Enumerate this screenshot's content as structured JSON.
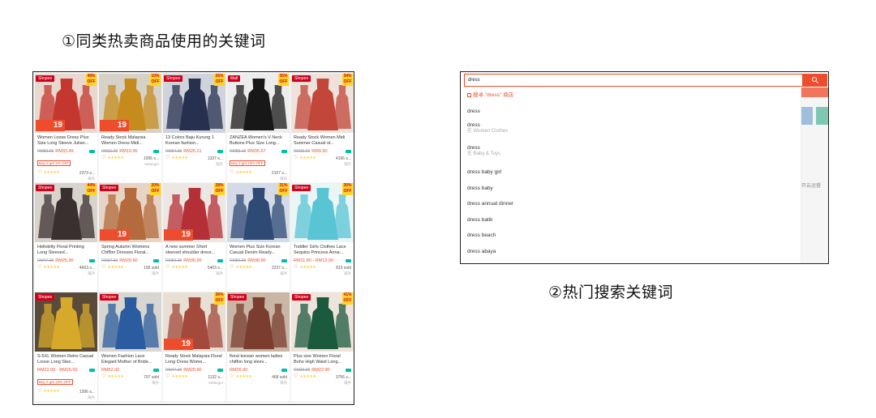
{
  "captions": {
    "similar_products": "①同类热卖商品使用的关键词",
    "hot_search": "②热门搜索关键词"
  },
  "products": [
    {
      "title": "Women Loose Dress Plus Size Long Sleeve Julian...",
      "old_price": "RM50.00",
      "price": "RM33.49",
      "promo": "Buy 2 get 3% OFF",
      "sold": "2373 s...",
      "location": "海外",
      "mall": "Shopee",
      "discount": "49% OFF",
      "sale": "19",
      "color": "#c4372e",
      "bg": "#ead7cf"
    },
    {
      "title": "Ready Stock Malaysia Women Dress Midi...",
      "old_price": "RM21.00",
      "price": "RM19.90",
      "promo": "",
      "sold": "1095 s...",
      "location": "Selangor",
      "mall": "",
      "discount": "10% OFF",
      "sale": "19",
      "color": "#c58b1d",
      "bg": "#d7d2c8"
    },
    {
      "title": "13 Colors Baju Kurung 1 Korean fashion...",
      "old_price": "RM34.00",
      "price": "RM25.21",
      "promo": "",
      "sold": "1337 s...",
      "location": "海外",
      "mall": "Shopee",
      "discount": "26% OFF",
      "sale": "",
      "color": "#27304f",
      "bg": "#cfd3dc"
    },
    {
      "title": "ZANZEA Women's V Neck Buttons Plus Size Long...",
      "old_price": "RM55.10",
      "price": "RM35.67",
      "promo": "Buy 2 get 10% OFF",
      "sold": "2167 s...",
      "location": "海外",
      "mall": "Mall",
      "discount": "35% OFF",
      "sale": "",
      "color": "#181818",
      "bg": "#ededed"
    },
    {
      "title": "Ready Stock Women Midi Summer Casual st...",
      "old_price": "RM15.00",
      "price": "RM9.90",
      "promo": "",
      "sold": "4166 s...",
      "location": "海外",
      "mall": "Shopee",
      "discount": "34% OFF",
      "sale": "",
      "color": "#c2463a",
      "bg": "#efe2da"
    },
    {
      "title": "Hellokitty Floral Printing Long Sleeved...",
      "old_price": "RM47.00",
      "price": "RM25.90",
      "promo": "",
      "sold": "4663 s...",
      "location": "海外",
      "mall": "Shopee",
      "discount": "44% OFF",
      "sale": "",
      "color": "#3a3030",
      "bg": "#d9d3cd"
    },
    {
      "title": "Spring Autumn Womens Chiffon Dresses Floral...",
      "old_price": "RM37.50",
      "price": "RM29.90",
      "promo": "",
      "sold": "195 sold",
      "location": "海外",
      "mall": "Shopee",
      "discount": "20% OFF",
      "sale": "19",
      "color": "#b46a3c",
      "bg": "#e6d5c4"
    },
    {
      "title": "A new summer Short sleeved shoulder dress...",
      "old_price": "RM50.00",
      "price": "RM35.99",
      "promo": "",
      "sold": "5403 s...",
      "location": "海外",
      "mall": "",
      "discount": "28% OFF",
      "sale": "19",
      "color": "#b52f36",
      "bg": "#ede7e3"
    },
    {
      "title": "Women Plus Size Korean Casual Denim Ready...",
      "old_price": "RM56.00",
      "price": "RM38.90",
      "promo": "",
      "sold": "2237 s...",
      "location": "海外",
      "mall": "",
      "discount": "31% OFF",
      "sale": "",
      "color": "#2e4a75",
      "bg": "#d4dbe6"
    },
    {
      "title": "Toddler Girls Clothes Lace Sequins Princess Anna...",
      "old_price": "",
      "price": "RM11.80 - RM13.00",
      "promo": "",
      "sold": "819 sold",
      "location": "海外",
      "mall": "Shopee",
      "discount": "30% OFF",
      "sale": "",
      "color": "#58c4d4",
      "bg": "#eaf5f6"
    },
    {
      "title": "S-5XL Women Retro Casual Loose Long Slee...",
      "old_price": "",
      "price": "RM22.00 - RM26.00",
      "promo": "Buy 2 get 10% OFF",
      "sold": "1396 s...",
      "location": "海外",
      "mall": "Shopee",
      "discount": "",
      "sale": "",
      "color": "#d7a92a",
      "bg": "#5a4a3a"
    },
    {
      "title": "Women Fashion Lace Elegant Mother of Bride...",
      "old_price": "",
      "price": "RM52.00",
      "promo": "",
      "sold": "707 sold",
      "location": "海外",
      "mall": "Shopee",
      "discount": "",
      "sale": "",
      "color": "#2b5c9f",
      "bg": "#d8d6d0"
    },
    {
      "title": "Ready Stock Malaysia Floral Long Dress Wome...",
      "old_price": "RM47.00",
      "price": "RM29.90",
      "promo": "",
      "sold": "1132 s...",
      "location": "Selangor",
      "mall": "",
      "discount": "36% OFF",
      "sale": "19",
      "color": "#a44a3c",
      "bg": "#e8e0d4"
    },
    {
      "title": "floral korean women ladies chiffon long sleev...",
      "old_price": "",
      "price": "RM26.90",
      "promo": "",
      "sold": "468 sold",
      "location": "海外",
      "mall": "Shopee",
      "discount": "",
      "sale": "",
      "color": "#7a3d30",
      "bg": "#c9b6a5"
    },
    {
      "title": "Plus size Women Floral Boho High Waist Long...",
      "old_price": "RM39.00",
      "price": "RM22.90",
      "promo": "",
      "sold": "3756 s...",
      "location": "海外",
      "mall": "Shopee",
      "discount": "41% OFF",
      "sale": "",
      "color": "#1c5a3e",
      "bg": "#efe4dc"
    }
  ],
  "search": {
    "query": "dress",
    "button_icon": "search-icon"
  },
  "suggestions": [
    {
      "text": "搜寻 \"dress\" 商店",
      "sub": "",
      "kind": "shop"
    },
    {
      "text": "dress",
      "sub": "",
      "kind": "plain"
    },
    {
      "text": "dress",
      "sub": "在 Women Clothes",
      "kind": "category"
    },
    {
      "text": "dress",
      "sub": "在 Baby & Toys",
      "kind": "category"
    },
    {
      "text": "dress baby girl",
      "sub": "",
      "kind": "plain"
    },
    {
      "text": "dress baby",
      "sub": "",
      "kind": "plain"
    },
    {
      "text": "dress annual dinner",
      "sub": "",
      "kind": "plain"
    },
    {
      "text": "dress batik",
      "sub": "",
      "kind": "plain"
    },
    {
      "text": "dress beach",
      "sub": "",
      "kind": "plain"
    },
    {
      "text": "dress abaya",
      "sub": "",
      "kind": "plain"
    }
  ],
  "background_text": "开云运营",
  "colors": {
    "accent": "#ee4d2d",
    "star": "#ffce3d",
    "free_ship": "#00bfa5"
  }
}
